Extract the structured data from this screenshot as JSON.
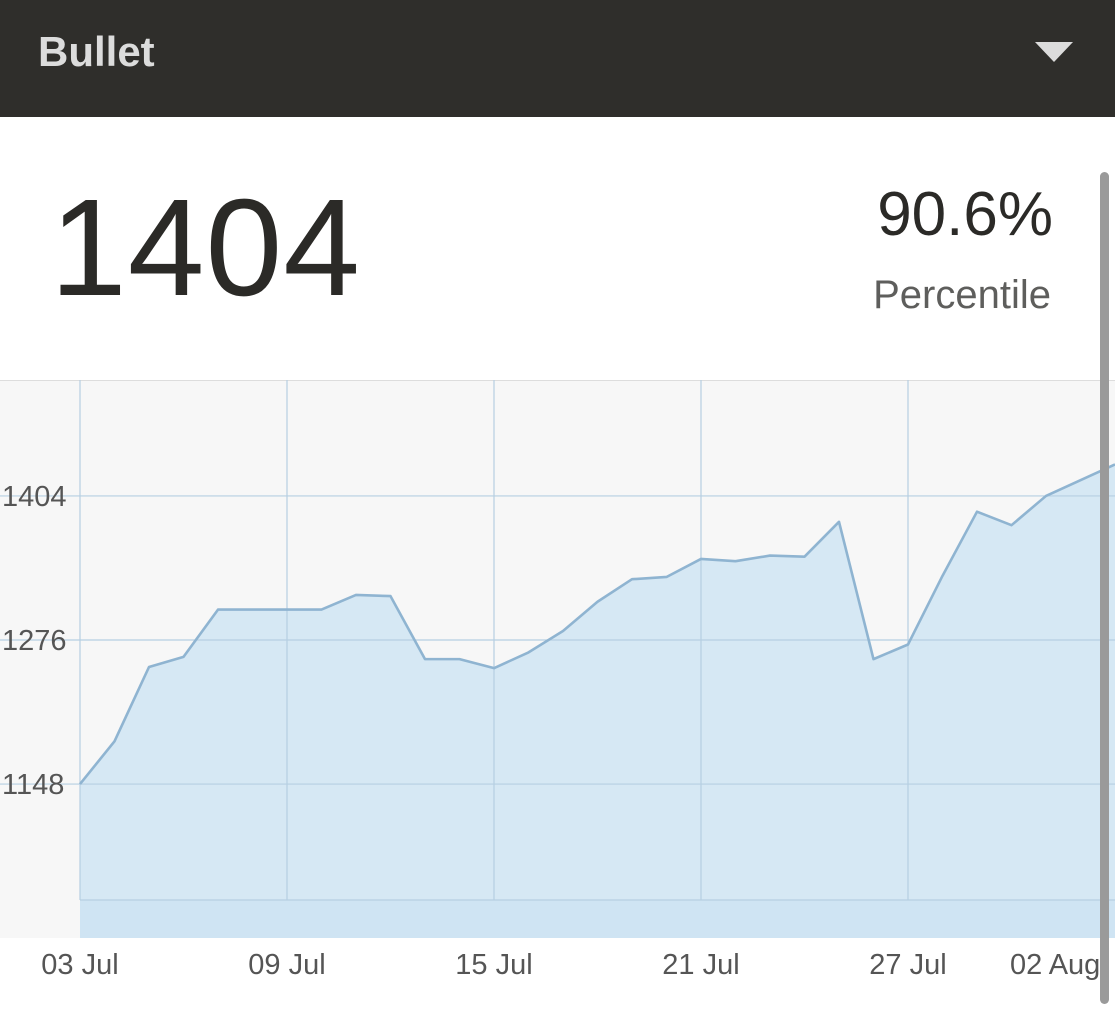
{
  "header": {
    "title": "Bullet",
    "dropdown_icon": "triangle-down-icon"
  },
  "summary": {
    "rating": "1404",
    "percentile_value": "90.6%",
    "percentile_label": "Percentile"
  },
  "colors": {
    "header_bg": "#2f2e2b",
    "line": "#8fb4d1",
    "area": "#d6e8f4",
    "grid": "#b6cfe2",
    "plot_bg": "#f7f7f7"
  },
  "chart_data": {
    "type": "area",
    "y_ticks": [
      1148,
      1276,
      1404
    ],
    "y_tick_labels": [
      "1148",
      "1276",
      "1404"
    ],
    "x_ticks": [
      "2023-07-03",
      "2023-07-09",
      "2023-07-15",
      "2023-07-21",
      "2023-07-27",
      "2023-08-02"
    ],
    "x_tick_labels": [
      "03 Jul",
      "09 Jul",
      "15 Jul",
      "21 Jul",
      "27 Jul",
      "02 Aug"
    ],
    "ylim": [
      1045,
      1507
    ],
    "xlim": [
      "2023-07-03",
      "2023-08-02"
    ],
    "grid": true,
    "series": [
      {
        "x": [
          "2023-07-03",
          "2023-07-04",
          "2023-07-05",
          "2023-07-06",
          "2023-07-07",
          "2023-07-08",
          "2023-07-09",
          "2023-07-10",
          "2023-07-11",
          "2023-07-12",
          "2023-07-13",
          "2023-07-14",
          "2023-07-15",
          "2023-07-16",
          "2023-07-17",
          "2023-07-18",
          "2023-07-19",
          "2023-07-20",
          "2023-07-21",
          "2023-07-22",
          "2023-07-23",
          "2023-07-24",
          "2023-07-25",
          "2023-07-26",
          "2023-07-27",
          "2023-07-28",
          "2023-07-29",
          "2023-07-30",
          "2023-07-31",
          "2023-08-01",
          "2023-08-02"
        ],
        "values": [
          1148,
          1186,
          1252,
          1261,
          1303,
          1303,
          1303,
          1303,
          1316,
          1315,
          1259,
          1259,
          1251,
          1265,
          1284,
          1310,
          1330,
          1332,
          1348,
          1346,
          1351,
          1350,
          1381,
          1259,
          1272,
          1333,
          1390,
          1378,
          1404,
          1418,
          1432
        ]
      }
    ]
  }
}
